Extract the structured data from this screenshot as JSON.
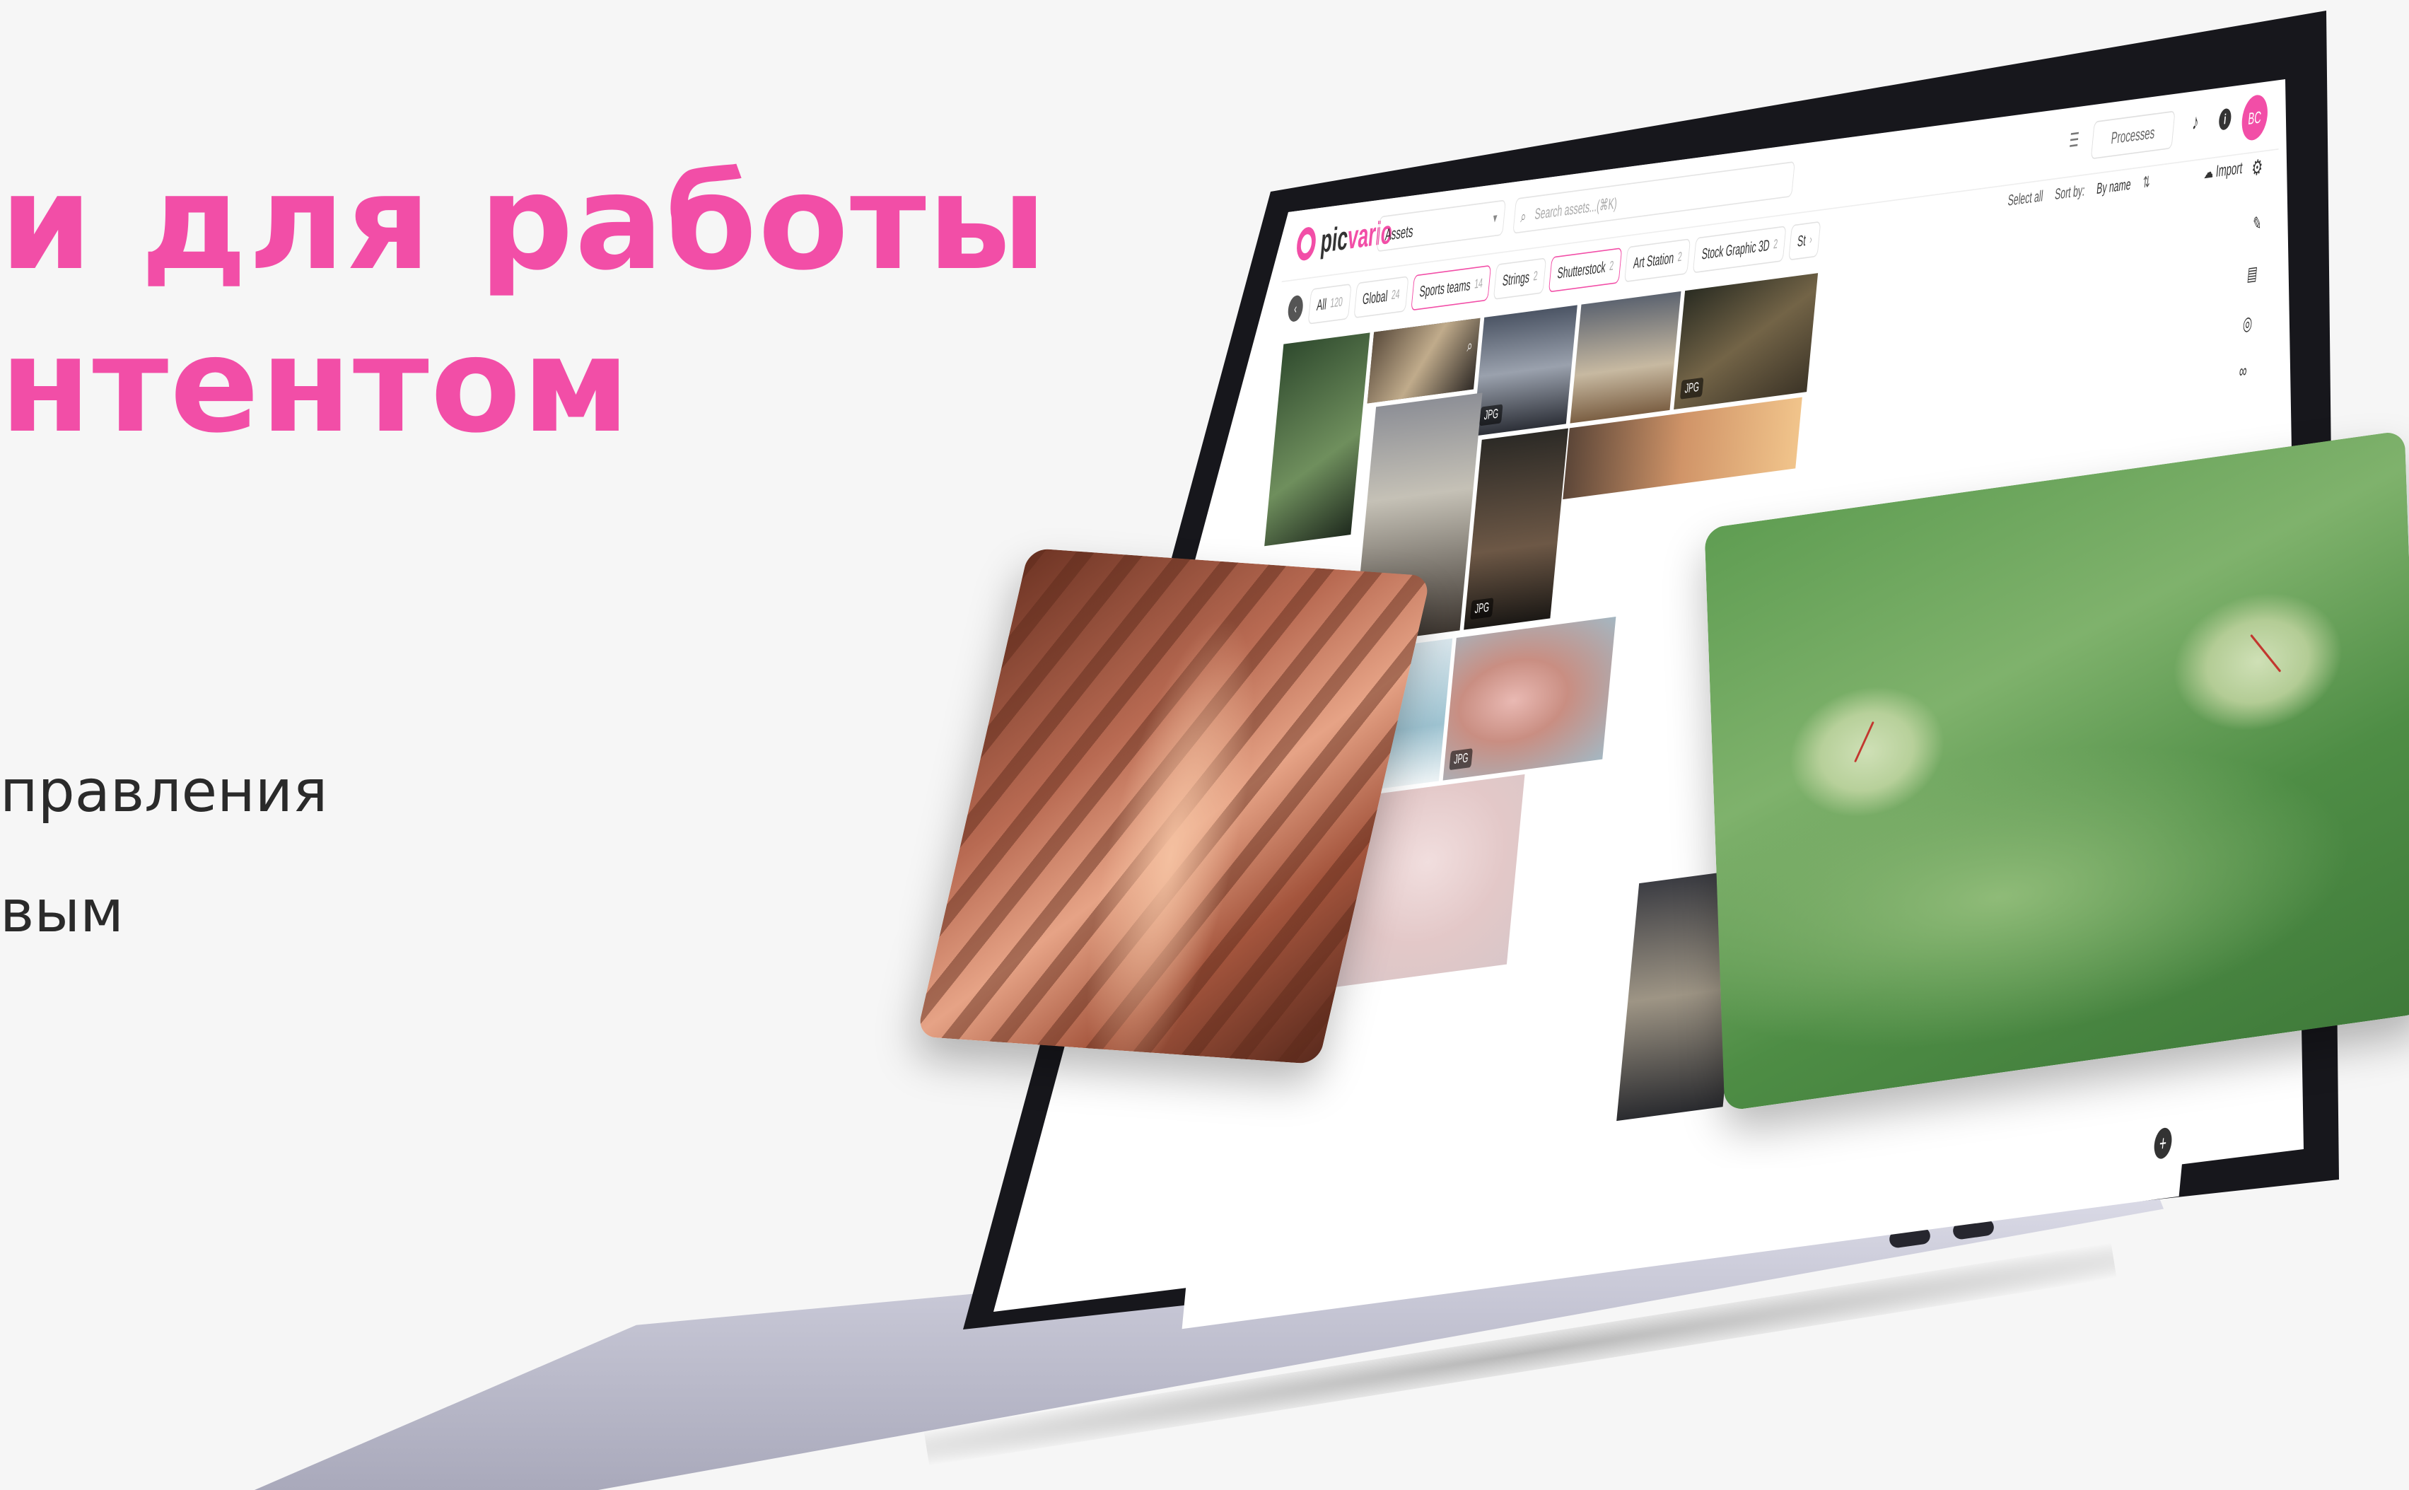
{
  "hero": {
    "headline_line1": "и для работы",
    "headline_line2": "нтентом",
    "sub_line1": "правления",
    "sub_line2": "вым"
  },
  "colors": {
    "accent": "#f24ea7",
    "text": "#2a2a2a",
    "background": "#f6f6f6"
  },
  "app": {
    "logo_left": "pic",
    "logo_right": "vario",
    "workspace_select": "Assets",
    "search_placeholder": "Search assets...(⌘K)",
    "processes_label": "Processes",
    "avatar_initials": "BC",
    "chips": [
      {
        "label": "All",
        "count": "120",
        "active": false
      },
      {
        "label": "Global",
        "count": "24",
        "active": false
      },
      {
        "label": "Sports teams",
        "count": "14",
        "active": true
      },
      {
        "label": "Strings",
        "count": "2",
        "active": false
      },
      {
        "label": "Shutterstock",
        "count": "2",
        "active": true
      },
      {
        "label": "Art Station",
        "count": "2",
        "active": false
      },
      {
        "label": "Stock Graphic 3D",
        "count": "2",
        "active": false
      },
      {
        "label": "St",
        "count": "›",
        "active": false
      }
    ],
    "select_all": "Select all",
    "sort_label": "Sort by:",
    "sort_value": "By name",
    "import_label": "Import",
    "file_tag": "JPG",
    "icons": [
      "filter-icon",
      "bell-icon",
      "info-icon",
      "gear-icon",
      "import-icon",
      "search-icon",
      "sort-order-icon",
      "plus-icon"
    ]
  }
}
